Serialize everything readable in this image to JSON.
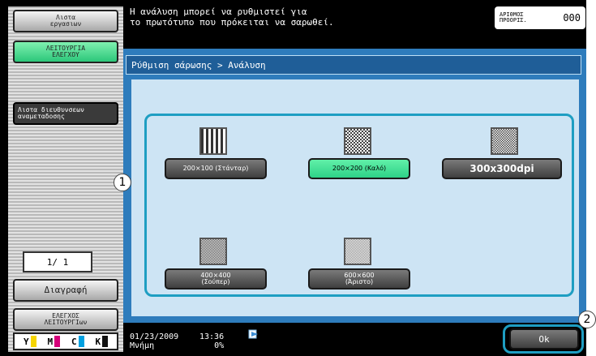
{
  "sidebar": {
    "job_list_label": "Λιστα\nεργασιων",
    "check_mode_label": "ΛΕΙΤΟΥΡΓΙΑ\nΕΛΕΓΧΟΥ",
    "address_list_label": "Λιστα διευθυνσεων\nαναμεταδοσης",
    "page_indicator": "1/  1",
    "delete_label": "Διαγραφή",
    "check_functions_label": "ΕΛΕΓΧΟΣ\nΛΕΙΤΟΥΡΓΙων",
    "toner": [
      {
        "label": "Y",
        "color": "#f5d400"
      },
      {
        "label": "M",
        "color": "#d6007a"
      },
      {
        "label": "C",
        "color": "#00a0e0"
      },
      {
        "label": "K",
        "color": "#111111"
      }
    ]
  },
  "header": {
    "message": "Η ανάλυση μπορεί να ρυθμιστεί για\nτο πρωτότυπο που πρόκειται να σαρωθεί.",
    "counter_label": "ΑΡΙΘΜΟΣ\nΠΡΟΟΡΙΣ.",
    "counter_value": "000"
  },
  "dialog": {
    "breadcrumb": "Ρύθμιση σάρωσης > Ανάλυση",
    "options": [
      {
        "label": "200×100 (Στάνταρ)",
        "selected": false
      },
      {
        "label": "200×200 (Καλό)",
        "selected": true
      },
      {
        "label": "300x300dpi",
        "selected": false
      },
      {
        "label": "400×400\n(Σούπερ)",
        "selected": false
      },
      {
        "label": "600×600\n(Άριστο)",
        "selected": false
      }
    ],
    "callout_1": "1",
    "callout_2": "2"
  },
  "footer": {
    "date": "01/23/2009",
    "memory_label": "Μνήμη",
    "time": "13:36",
    "memory_value": "0%",
    "ok_label": "Ok"
  }
}
